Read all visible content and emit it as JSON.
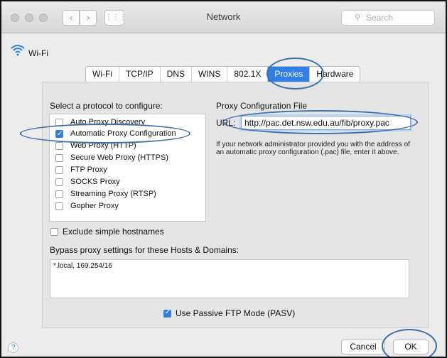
{
  "window": {
    "title": "Network",
    "search_placeholder": "Search"
  },
  "interface": {
    "name": "Wi-Fi"
  },
  "tabs": [
    {
      "label": "Wi-Fi"
    },
    {
      "label": "TCP/IP"
    },
    {
      "label": "DNS"
    },
    {
      "label": "WINS"
    },
    {
      "label": "802.1X"
    },
    {
      "label": "Proxies",
      "active": true
    },
    {
      "label": "Hardware"
    }
  ],
  "proxies": {
    "select_title": "Select a protocol to configure:",
    "protocols": [
      {
        "label": "Auto Proxy Discovery",
        "checked": false
      },
      {
        "label": "Automatic Proxy Configuration",
        "checked": true
      },
      {
        "label": "Web Proxy (HTTP)",
        "checked": false
      },
      {
        "label": "Secure Web Proxy (HTTPS)",
        "checked": false
      },
      {
        "label": "FTP Proxy",
        "checked": false
      },
      {
        "label": "SOCKS Proxy",
        "checked": false
      },
      {
        "label": "Streaming Proxy (RTSP)",
        "checked": false
      },
      {
        "label": "Gopher Proxy",
        "checked": false
      }
    ],
    "config_file_title": "Proxy Configuration File",
    "url_label": "URL:",
    "url_value": "http://pac.det.nsw.edu.au/fib/proxy.pac",
    "help_text": "If your network administrator provided you with the address of an automatic proxy configuration (.pac) file, enter it above.",
    "exclude_simple": {
      "label": "Exclude simple hostnames",
      "checked": false
    },
    "bypass_title": "Bypass proxy settings for these Hosts & Domains:",
    "bypass_value": "*.local, 169.254/16",
    "passive_ftp": {
      "label": "Use Passive FTP Mode (PASV)",
      "checked": true
    }
  },
  "footer": {
    "help": "?",
    "cancel": "Cancel",
    "ok": "OK"
  },
  "colors": {
    "accent": "#2f7fe6",
    "annotation": "#3f6ea5"
  }
}
